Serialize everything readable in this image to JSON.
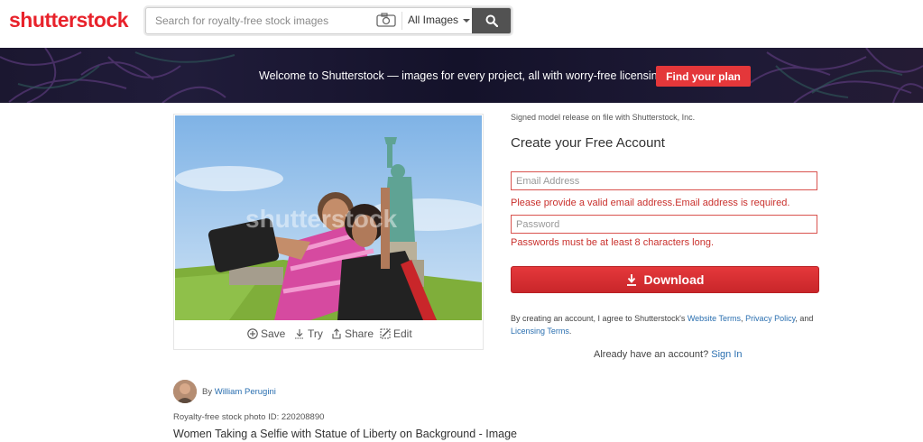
{
  "header": {
    "logo_text": "shutterstock",
    "search": {
      "placeholder": "Search for royalty-free stock images",
      "value": ""
    },
    "image_type_select": "All Images",
    "icons": [
      "camera-icon",
      "search-icon",
      "chevron-down-icon"
    ]
  },
  "banner": {
    "text": "Welcome to Shutterstock — images for every project, all with worry-free licensing.",
    "button_label": "Find your plan"
  },
  "image": {
    "watermark": "shutterstock",
    "actions": {
      "save": "Save",
      "try": "Try",
      "share": "Share",
      "edit": "Edit"
    },
    "author_prefix": "By",
    "author_name": "William Perugini",
    "photo_id": "Royalty-free stock photo ID: 220208890",
    "title": "Women Taking a Selfie with Statue of Liberty on Background - Image"
  },
  "form": {
    "model_release": "Signed model release on file with Shutterstock, Inc.",
    "title": "Create your Free Account",
    "email_placeholder": "Email Address",
    "email_error": "Please provide a valid email address.Email address is required.",
    "password_placeholder": "Password",
    "password_error": "Passwords must be at least 8 characters long.",
    "download_label": "Download",
    "terms_prefix": "By creating an account, I agree to Shutterstock's",
    "terms_link1": "Website Terms",
    "terms_sep": ",",
    "terms_link2": "Privacy Policy",
    "terms_and": ", and",
    "terms_link3": "Licensing Terms",
    "terms_end": ".",
    "have_account": "Already have an account?",
    "sign_in": "Sign In"
  },
  "colors": {
    "brand_red": "#e8222b",
    "button_red": "#e4373a",
    "error_red": "#c9302c",
    "link_blue": "#2a6fb0"
  }
}
